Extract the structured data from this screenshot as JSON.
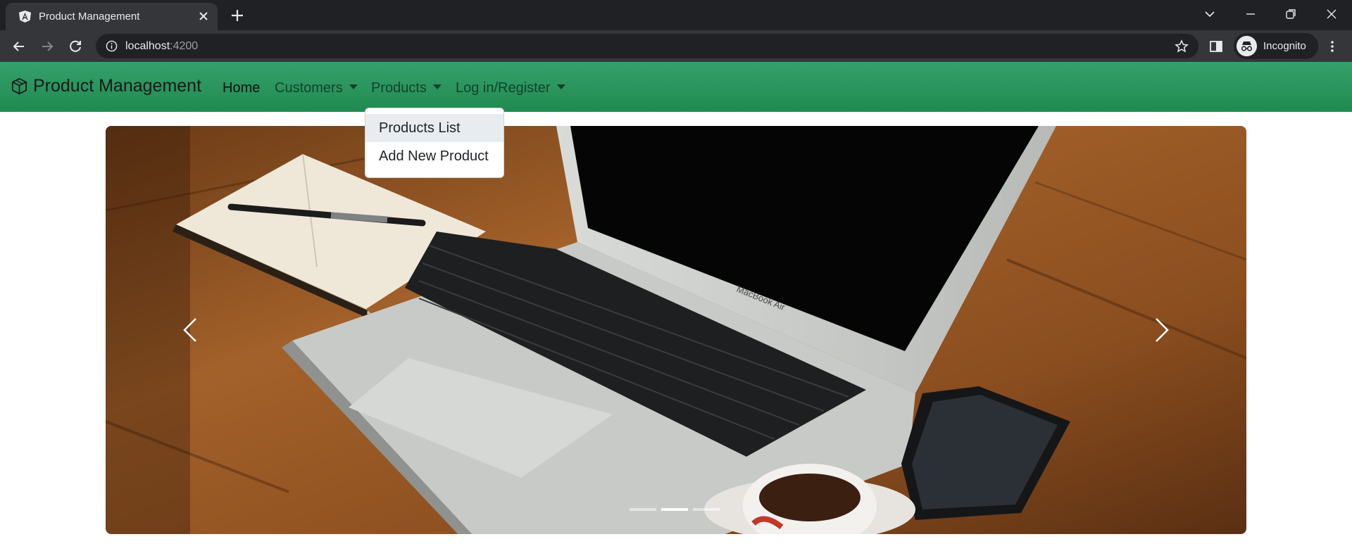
{
  "browser": {
    "tab_title": "Product Management",
    "url_host": "localhost",
    "url_port": ":4200",
    "profile_label": "Incognito"
  },
  "navbar": {
    "brand": "Product Management",
    "links": {
      "home": "Home",
      "customers": "Customers",
      "products": "Products",
      "login": "Log in/Register"
    },
    "accent_color": "#2b9560"
  },
  "products_dropdown": {
    "items": [
      "Products List",
      "Add New Product"
    ],
    "hovered_item": "Products List"
  },
  "carousel": {
    "slide_count": 3,
    "active_slide": 2,
    "photo_lettering": "MacBook Air"
  }
}
